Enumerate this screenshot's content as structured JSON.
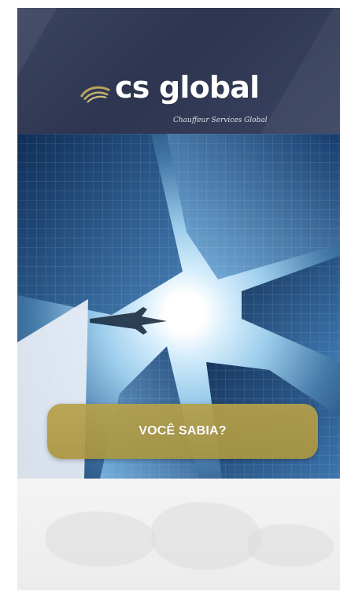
{
  "brand": {
    "name": "cs global",
    "subtitle": "Chauffeur Services Global",
    "colors": {
      "header_bg": "#2d3550",
      "accent_gold": "#b6a04a",
      "text_white": "#ffffff"
    },
    "logo_icon": "swoosh-logo-icon"
  },
  "hero": {
    "image_name": "skyscrapers-looking-up-image"
  },
  "cta": {
    "label": "VOCÊ SABIA?"
  },
  "bottom": {
    "background_name": "world-map-background"
  }
}
